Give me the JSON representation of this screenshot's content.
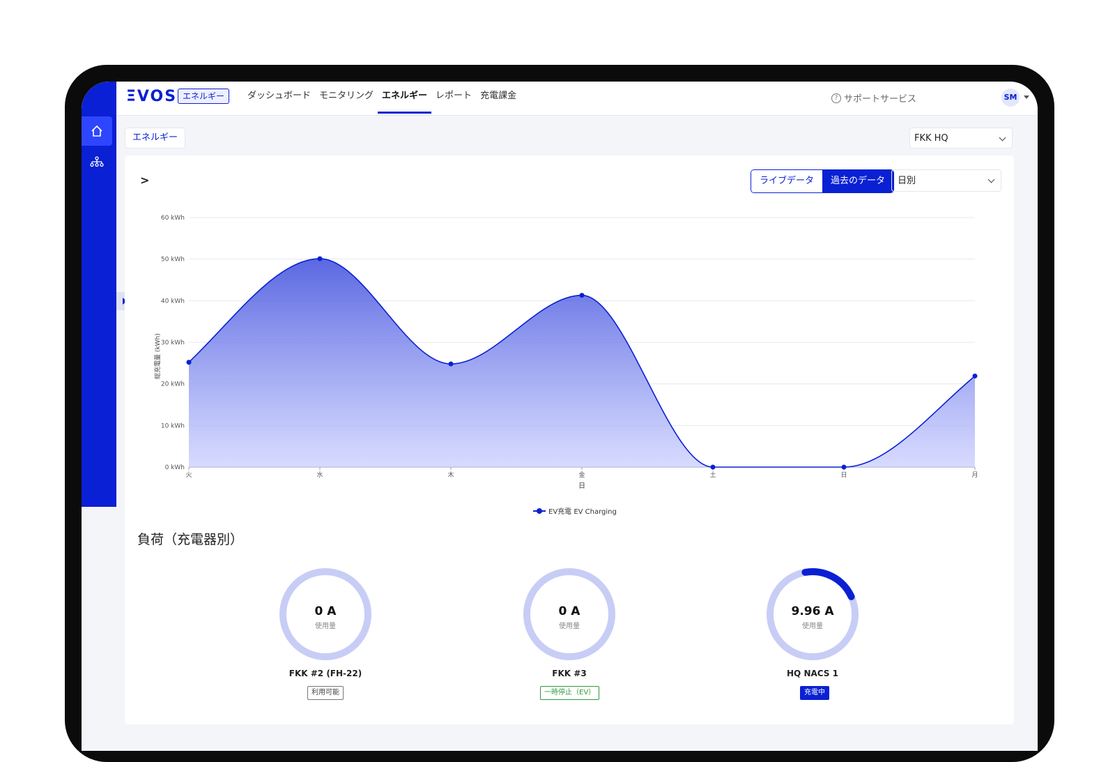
{
  "header": {
    "logo": "ΞVOS",
    "app_badge": "エネルギー",
    "nav": [
      {
        "label": "ダッシュボード",
        "active": false
      },
      {
        "label": "モニタリング",
        "active": false
      },
      {
        "label": "エネルギー",
        "active": true
      },
      {
        "label": "レポート",
        "active": false
      },
      {
        "label": "充電課金",
        "active": false
      }
    ],
    "support_label": "サポートサービス",
    "user_initials": "SM"
  },
  "breadcrumb": "エネルギー",
  "site_select": "FKK HQ",
  "card": {
    "expand_symbol": ">",
    "view_toggle": [
      {
        "label": "ライブデータ",
        "active": false
      },
      {
        "label": "過去のデータ",
        "active": true
      }
    ],
    "period_select": "日別"
  },
  "colors": {
    "accent": "#0a20d4",
    "ring_track": "#c8cdf6",
    "status_green": "#2e9a3c"
  },
  "chart_data": {
    "type": "area",
    "ylabel": "総充電量 (kWh)",
    "xlabel": "日",
    "categories": [
      "火",
      "水",
      "木",
      "金",
      "土",
      "日",
      "月"
    ],
    "y_ticks": [
      "0 kWh",
      "10 kWh",
      "20 kWh",
      "30 kWh",
      "40 kWh",
      "50 kWh",
      "60 kWh"
    ],
    "ylim": [
      0,
      60
    ],
    "grid": true,
    "legend_position": "bottom",
    "series": [
      {
        "name": "EV充電 EV Charging",
        "values": [
          25.2,
          50.1,
          24.8,
          41.3,
          0,
          0,
          21.9
        ]
      }
    ]
  },
  "load_section": {
    "title": "負荷（充電器別）",
    "chargers": [
      {
        "value": "0 A",
        "unit": "使用量",
        "name": "FKK #2 (FH-22)",
        "status": "利用可能",
        "fraction": 0
      },
      {
        "value": "0 A",
        "unit": "使用量",
        "name": "FKK #3",
        "status": "一時停止（EV）",
        "fraction": 0
      },
      {
        "value": "9.96 A",
        "unit": "使用量",
        "name": "HQ NACS 1",
        "status": "充電中",
        "fraction": 0.21
      }
    ]
  }
}
